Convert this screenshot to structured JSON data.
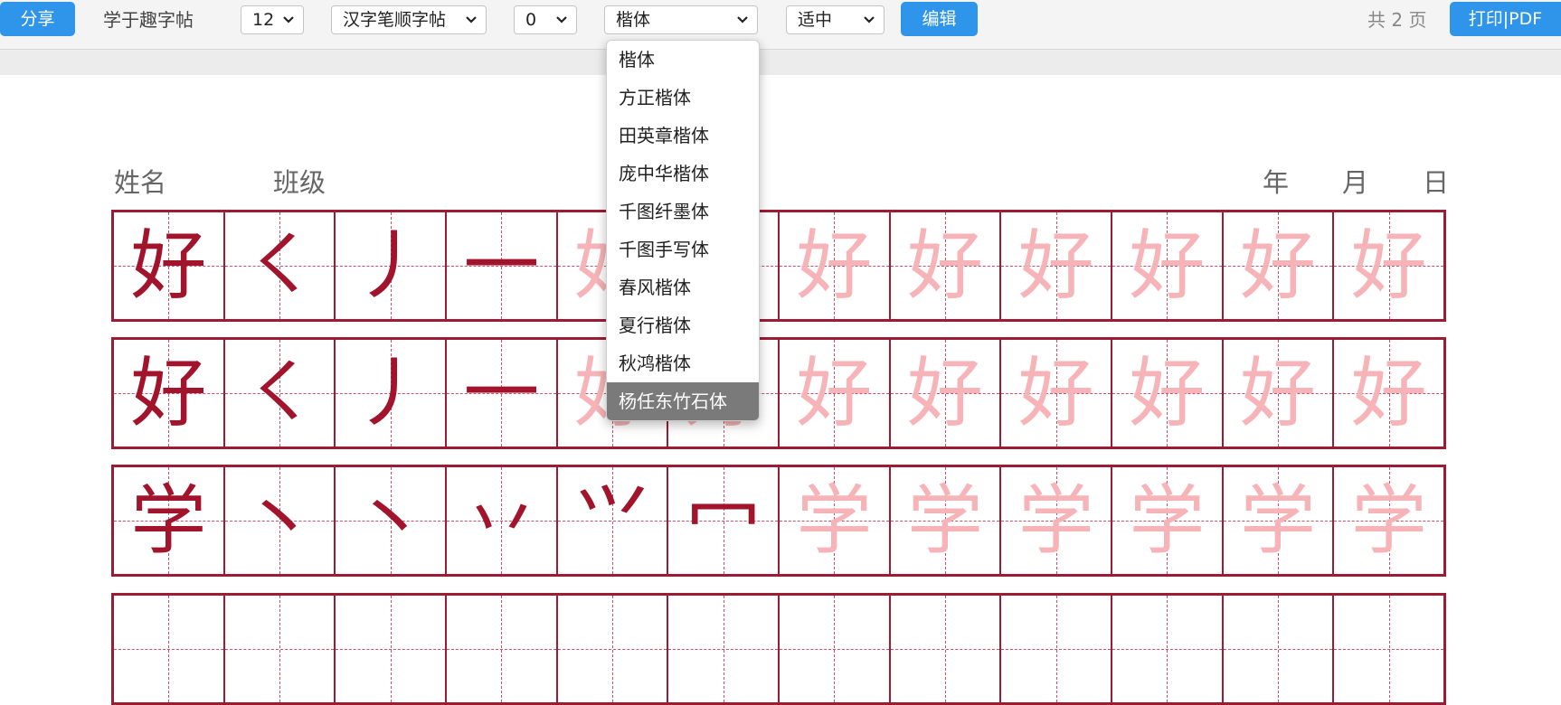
{
  "toolbar": {
    "share_label": "分享",
    "app_title": "学于趣字帖",
    "count_value": "12",
    "mode_value": "汉字笔顺字帖",
    "offset_value": "0",
    "font_value": "楷体",
    "size_value": "适中",
    "edit_label": "编辑",
    "pages_text": "共 2 页",
    "print_label": "打印|PDF"
  },
  "font_options": [
    "楷体",
    "方正楷体",
    "田英章楷体",
    "庞中华楷体",
    "千图纤墨体",
    "千图手写体",
    "春风楷体",
    "夏行楷体",
    "秋鸿楷体",
    "杨任东竹石体"
  ],
  "highlighted_option": "杨任东竹石体",
  "header": {
    "name_label": "姓名",
    "class_label": "班级",
    "year_label": "年",
    "month_label": "月",
    "day_label": "日"
  },
  "practice_rows": [
    {
      "cells": [
        "好",
        "㇛",
        "丿",
        "一",
        "好",
        "好",
        "好",
        "好",
        "好",
        "好",
        "好",
        "好"
      ],
      "main_count": 4
    },
    {
      "cells": [
        "好",
        "㇛",
        "丿",
        "一",
        "好",
        "好",
        "好",
        "好",
        "好",
        "好",
        "好",
        "好"
      ],
      "main_count": 4
    },
    {
      "cells": [
        "学",
        "丶",
        "丶",
        "丷",
        "⺍",
        "冖",
        "学",
        "学",
        "学",
        "学",
        "学",
        "学"
      ],
      "main_count": 6
    }
  ],
  "colors": {
    "accent": "#2f95ea",
    "grid": "#9e1b34",
    "main_glyph": "#a2132c",
    "ghost_glyph": "#f6b4b8"
  }
}
